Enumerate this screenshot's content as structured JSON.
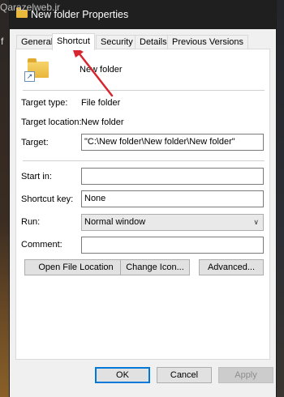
{
  "watermark": "Qarazelweb.ir",
  "stray_char": "f",
  "window": {
    "title": "New folder Properties"
  },
  "tabs": [
    {
      "label": "General"
    },
    {
      "label": "Shortcut"
    },
    {
      "label": "Security"
    },
    {
      "label": "Details"
    },
    {
      "label": "Previous Versions"
    }
  ],
  "active_tab": "Shortcut",
  "header": {
    "name": "New folder"
  },
  "fields": {
    "target_type_label": "Target type:",
    "target_type_value": "File folder",
    "target_location_label": "Target location:",
    "target_location_value": "New folder",
    "target_label": "Target:",
    "target_value": "\"C:\\New folder\\New folder\\New folder\"",
    "start_in_label": "Start in:",
    "start_in_value": "",
    "shortcut_key_label": "Shortcut key:",
    "shortcut_key_value": "None",
    "run_label": "Run:",
    "run_value": "Normal window",
    "comment_label": "Comment:",
    "comment_value": ""
  },
  "action_buttons": {
    "open_file_location": "Open File Location",
    "change_icon": "Change Icon...",
    "advanced": "Advanced..."
  },
  "dialog_buttons": {
    "ok": "OK",
    "cancel": "Cancel",
    "apply": "Apply"
  },
  "colors": {
    "titlebar": "#1f1f1f",
    "annotation_arrow": "#d8262e",
    "focus_accent": "#0078d7"
  },
  "icons": [
    "folder-icon",
    "shortcut-overlay-icon",
    "chevron-down-icon"
  ]
}
